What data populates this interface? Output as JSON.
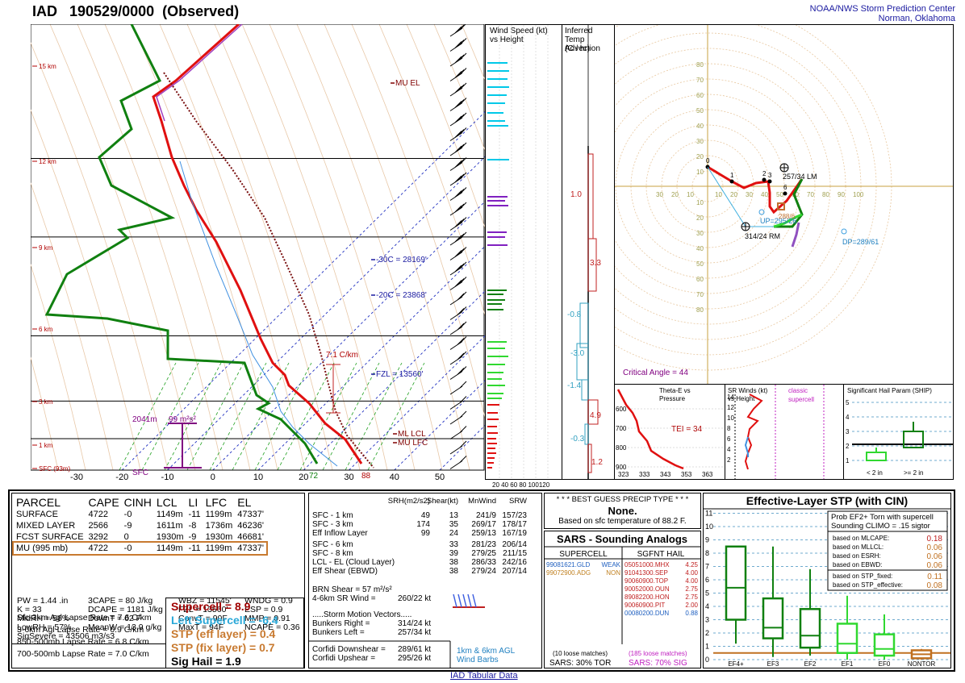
{
  "header": {
    "station": "IAD",
    "datetime": "190529/0000",
    "status": "(Observed)",
    "org_line1": "NOAA/NWS Storm Prediction Center",
    "org_line2": "Norman, Oklahoma"
  },
  "skewt": {
    "pressure_labels": [
      "100",
      "200",
      "300",
      "500",
      "700",
      "850",
      "1000"
    ],
    "height_labels": [
      "15 km",
      "12 km",
      "9 km",
      "6 km",
      "3 km",
      "1 km",
      "SFC (93m)"
    ],
    "temp_labels": [
      "-30",
      "-20",
      "-10",
      "0",
      "10",
      "20",
      "30",
      "40",
      "50"
    ],
    "annotations": {
      "mu_el": "MU EL",
      "m30c": "-30C = 28169'",
      "m20c": "-20C = 23868'",
      "fzl": "FZL = 13560'",
      "ml_lcl": "ML LCL",
      "mu_lfc": "MU LFC",
      "lapse": "7.1 C/km",
      "srh_depth": "2041m",
      "srh_val": "99 m²s²",
      "sfc": "SFC",
      "t72": "72",
      "t88": "88"
    }
  },
  "wind_panel": {
    "title1": "Wind Speed (kt)",
    "title2": "vs Height",
    "axis": "20 40 60 80 100120"
  },
  "adv_panel": {
    "title1": "Inferred",
    "title2": "Temp Advection",
    "title3": "(C / hr)",
    "values": [
      "1.0",
      "3.3",
      "-0.8",
      "-3.0",
      "-1.4",
      "4.9",
      "-0.3",
      "1.2"
    ]
  },
  "hodograph": {
    "rings": [
      "10",
      "20",
      "30",
      "40",
      "50",
      "60",
      "70",
      "80"
    ],
    "xlabels": [
      "30",
      "20",
      "10",
      "10",
      "20",
      "30",
      "40",
      "50",
      "60",
      "70",
      "80",
      "90",
      "100"
    ],
    "labels": {
      "lm": "257/34 LM",
      "rm": "314/24 RM",
      "up": "UP=295/26",
      "dp": "DP=289/61",
      "crit": "Critical Angle = 44",
      "dn": "288/6"
    },
    "pts": [
      "0",
      "1",
      "2",
      "3",
      "6"
    ]
  },
  "theta_panel": {
    "title1": "Theta-E vs",
    "title2": "Pressure",
    "tei": "TEI = 34",
    "ylabels": [
      "600",
      "700",
      "800",
      "900"
    ],
    "xlabels": [
      "323",
      "333",
      "343",
      "353",
      "363"
    ]
  },
  "srwind_panel": {
    "title1": "SR Winds (kt)",
    "title2": "vs Height",
    "classic1": "classic",
    "classic2": "supercell",
    "ylabels": [
      "14",
      "12",
      "10",
      "8",
      "6",
      "4",
      "2"
    ]
  },
  "ship_panel": {
    "title": "Significant Hail Param (SHIP)",
    "ylabels": [
      "5",
      "4",
      "3",
      "2",
      "1"
    ],
    "xlabels": [
      "< 2 in",
      ">= 2 in"
    ]
  },
  "parcel_table": {
    "headers": [
      "PARCEL",
      "CAPE",
      "CINH",
      "LCL",
      "LI",
      "LFC",
      "EL"
    ],
    "rows": [
      [
        "SURFACE",
        "4722",
        "-0",
        "1149m",
        "-11",
        "1199m",
        "47337'"
      ],
      [
        "MIXED LAYER",
        "2566",
        "-9",
        "1611m",
        "-8",
        "1736m",
        "46236'"
      ],
      [
        "FCST SURFACE",
        "3292",
        "0",
        "1930m",
        "-9",
        "1930m",
        "46681'"
      ],
      [
        "MU  (995 mb)",
        "4722",
        "-0",
        "1149m",
        "-11",
        "1199m",
        "47337'"
      ]
    ]
  },
  "indices": {
    "col1": [
      "PW = 1.44 .in",
      "K = 33",
      "MidRH = 56%",
      "LowRH = 57%",
      "SigSevere = 43506 m3/s3"
    ],
    "col2": [
      "3CAPE = 80 J/kg",
      "DCAPE = 1181 J/kg",
      "DownT = 62 F",
      "MeanW = 13.9 g/kg"
    ],
    "col3": [
      "WBZ = 11545'",
      "FZL = 13560'",
      "ConvT = 90F",
      "MaxT = 94F"
    ],
    "col4": [
      "WNDG = 0.9",
      "ESP = 0.9",
      "MMP = 0.91",
      "NCAPE = 0.36"
    ]
  },
  "lapse_rates": [
    "Sfc-3km Agl Lapse Rate =  7.6 C/km",
    "3-6km Agl Lapse Rate =  6.9 C/km",
    "850-500mb Lapse Rate =  6.8 C/km",
    "700-500mb Lapse Rate =  7.0 C/km"
  ],
  "composites": {
    "supercell": "Supercell = 8.9",
    "left_supercell": "Left Supercell = -6.4",
    "stp_eff": "STP (eff layer) = 0.4",
    "stp_fix": "STP (fix layer) = 0.7",
    "sig_hail": "Sig Hail = 1.9"
  },
  "kinematics": {
    "headers": [
      "SRH(m2/s2)",
      "Shear(kt)",
      "MnWind",
      "SRW"
    ],
    "rows1": [
      [
        "SFC - 1 km",
        "49",
        "13",
        "241/9",
        "157/23"
      ],
      [
        "SFC - 3 km",
        "174",
        "35",
        "269/17",
        "178/17"
      ],
      [
        "Eff Inflow Layer",
        "99",
        "24",
        "259/13",
        "167/19"
      ]
    ],
    "rows2": [
      [
        "SFC - 6 km",
        "",
        "33",
        "281/23",
        "206/14"
      ],
      [
        "SFC - 8 km",
        "",
        "39",
        "279/25",
        "211/15"
      ],
      [
        "LCL - EL (Cloud Layer)",
        "",
        "38",
        "286/33",
        "242/16"
      ],
      [
        "Eff Shear (EBWD)",
        "",
        "38",
        "279/24",
        "207/14"
      ]
    ],
    "brn": "BRN Shear = 57 m²/s²",
    "sr4_6": "4-6km SR Wind =",
    "sr4_6v": "260/22 kt",
    "storm_motion": ".....Storm Motion Vectors.....",
    "bunkers_r": "Bunkers Right =",
    "bunkers_rv": "314/24 kt",
    "bunkers_l": "Bunkers Left =",
    "bunkers_lv": "257/34 kt",
    "corfidi_d": "Corfidi Downshear =",
    "corfidi_dv": "289/61 kt",
    "corfidi_u": "Corfidi Upshear =",
    "corfidi_uv": "295/26 kt",
    "barb_label1": "1km & 6km AGL",
    "barb_label2": "Wind Barbs"
  },
  "precip": {
    "title": "* * * BEST GUESS PRECIP TYPE * * *",
    "value": "None.",
    "note": "Based on sfc temperature of 88.2 F."
  },
  "sars": {
    "title": "SARS - Sounding Analogs",
    "supercell_h": "SUPERCELL",
    "hail_h": "SGFNT HAIL",
    "supercell": [
      [
        "99081621.GLD",
        "WEAK"
      ],
      [
        "99072900.ADG",
        "NON"
      ]
    ],
    "hail": [
      [
        "05051000.MHX",
        "4.25"
      ],
      [
        "91041300.SEP",
        "4.00"
      ],
      [
        "90060900.TOP",
        "4.00"
      ],
      [
        "90052000.OUN",
        "2.75"
      ],
      [
        "89082200.HON",
        "2.75"
      ],
      [
        "90060900.PIT",
        "2.00"
      ],
      [
        "00080200.DUN",
        "0.88"
      ]
    ],
    "loose_sup": "(10 loose matches)",
    "loose_hail": "(185 loose matches)",
    "sars_tor": "SARS:  30% TOR",
    "sars_sig": "SARS:  70% SIG"
  },
  "stp": {
    "title": "Effective-Layer STP (with CIN)",
    "prob1": "Prob EF2+ Torn with supercell",
    "prob2": "Sounding CLIMO = .15 sigtor",
    "rows": [
      [
        "based on MLCAPE:",
        "0.18"
      ],
      [
        "based on MLLCL:",
        "0.06"
      ],
      [
        "based on ESRH:",
        "0.06"
      ],
      [
        "based on EBWD:",
        "0.06"
      ],
      [
        "based on STP_fixed:",
        "0.11"
      ],
      [
        "based on STP_effective:",
        "0.08"
      ]
    ],
    "ylabels": [
      "11",
      "10",
      "9",
      "8",
      "7",
      "6",
      "5",
      "4",
      "3",
      "2",
      "1",
      "0"
    ],
    "xlabels": [
      "EF4+",
      "EF3",
      "EF2",
      "EF1",
      "EF0",
      "NONTOR"
    ]
  },
  "footer": "IAD Tabular Data",
  "chart_data": [
    {
      "type": "line",
      "title": "",
      "xlabel": "",
      "ylabel": "",
      "ylim": [
        1000,
        100
      ],
      "xlim": [
        -30,
        50
      ],
      "y_axis_scale": "log-pressure",
      "series": []
    },
    {
      "type": "bar",
      "categories": [
        "EF4+",
        "EF3",
        "EF2",
        "EF1",
        "EF0",
        "NONTOR"
      ],
      "ylim": [
        0,
        11
      ],
      "series": [
        {
          "name": "",
          "values": [
            5.4,
            2.4,
            1.8,
            1.2,
            0.8,
            0.4
          ]
        }
      ]
    }
  ]
}
